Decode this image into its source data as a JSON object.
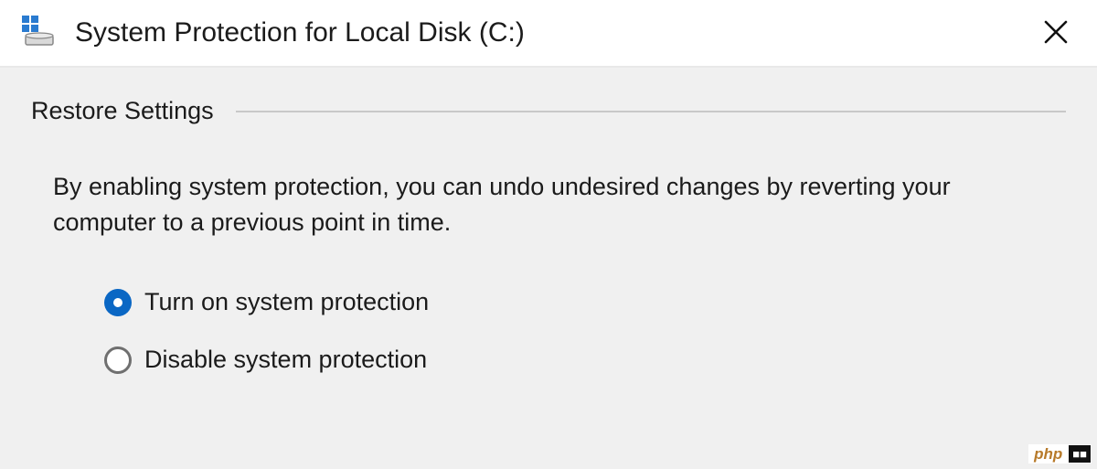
{
  "titlebar": {
    "title": "System Protection for Local Disk (C:)"
  },
  "section": {
    "heading": "Restore Settings",
    "description": "By enabling system protection, you can undo undesired changes by reverting your computer to a previous point in time."
  },
  "options": {
    "turn_on": {
      "label": "Turn on system protection",
      "selected": true
    },
    "disable": {
      "label": "Disable system protection",
      "selected": false
    }
  },
  "watermark": {
    "left": "php",
    "right": "■■"
  }
}
